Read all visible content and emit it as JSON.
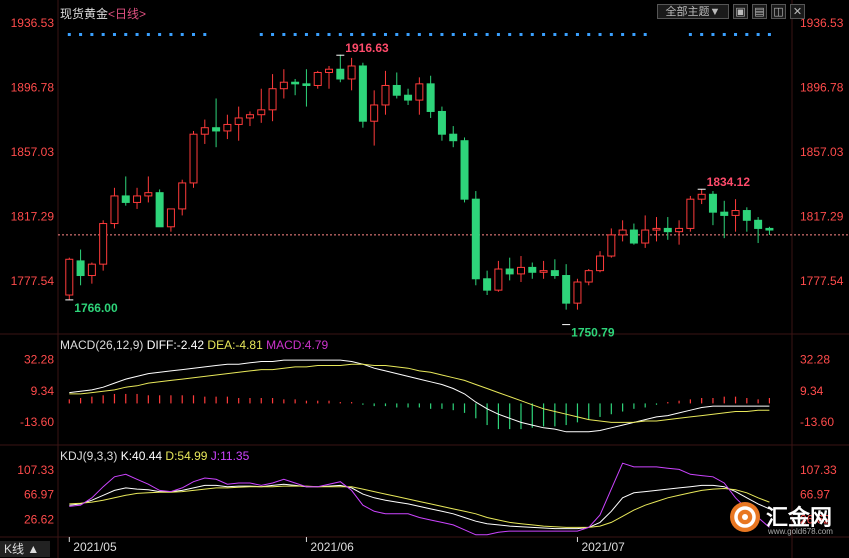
{
  "header": {
    "title": "现货黄金",
    "period": "<日线>",
    "theme_button": "全部主题▼",
    "icons": [
      "zoom-in-icon",
      "zoom-out-icon",
      "fullscreen-icon",
      "close-icon"
    ]
  },
  "macd": {
    "label": "MACD(26,12,9)",
    "diff": "DIFF:-2.42",
    "dea": "DEA:-4.81",
    "macd": "MACD:4.79"
  },
  "kdj": {
    "label": "KDJ(9,3,3)",
    "k": "K:40.44",
    "d": "D:54.99",
    "j": "J:11.35"
  },
  "footer": {
    "kline_tab": "K线",
    "brand": "汇金网",
    "brand_url": "www.gold678.com"
  },
  "colors": {
    "up": "#ff3b3b",
    "down": "#2ed47a",
    "diff": "#ffffff",
    "dea": "#e8e85a",
    "macd_label": "#cc33cc",
    "k": "#ffffff",
    "d": "#e8e85a",
    "j": "#cc44ff",
    "grid": "#2a1010",
    "axis_text": "#ff4b4b"
  },
  "chart_data": {
    "type": "candlestick",
    "y_ticks_price": [
      "1936.53",
      "1896.78",
      "1857.03",
      "1817.29",
      "1777.54"
    ],
    "y_ticks_macd": [
      "32.28",
      "9.34",
      "-13.60"
    ],
    "y_ticks_kdj": [
      "107.33",
      "66.97",
      "26.62"
    ],
    "x_ticks": [
      "2021/05",
      "2021/06",
      "2021/07"
    ],
    "annotations": {
      "high1": "1916.63",
      "low1": "1766.00",
      "low2": "1750.79",
      "high2": "1834.12"
    },
    "last_price": 1806,
    "ylim_price": [
      1745,
      1942
    ],
    "ylim_macd": [
      -30,
      38
    ],
    "ylim_kdj": [
      0,
      120
    ],
    "candles": [
      [
        1769,
        1792,
        1766,
        1791
      ],
      [
        1790,
        1797,
        1775,
        1781
      ],
      [
        1781,
        1789,
        1776,
        1788
      ],
      [
        1788,
        1815,
        1784,
        1813
      ],
      [
        1813,
        1835,
        1810,
        1830
      ],
      [
        1830,
        1842,
        1824,
        1826
      ],
      [
        1826,
        1835,
        1822,
        1830
      ],
      [
        1830,
        1842,
        1826,
        1832
      ],
      [
        1832,
        1834,
        1812,
        1811
      ],
      [
        1811,
        1822,
        1808,
        1822
      ],
      [
        1822,
        1840,
        1818,
        1838
      ],
      [
        1838,
        1870,
        1835,
        1868
      ],
      [
        1868,
        1877,
        1862,
        1872
      ],
      [
        1872,
        1890,
        1860,
        1870
      ],
      [
        1870,
        1880,
        1865,
        1874
      ],
      [
        1874,
        1885,
        1864,
        1878
      ],
      [
        1878,
        1882,
        1873,
        1880
      ],
      [
        1880,
        1896,
        1875,
        1883
      ],
      [
        1883,
        1905,
        1876,
        1896
      ],
      [
        1896,
        1908,
        1890,
        1900
      ],
      [
        1900,
        1902,
        1892,
        1899
      ],
      [
        1899,
        1908,
        1885,
        1898
      ],
      [
        1898,
        1907,
        1896,
        1906
      ],
      [
        1906,
        1910,
        1896,
        1908
      ],
      [
        1908,
        1917,
        1900,
        1902
      ],
      [
        1902,
        1915,
        1895,
        1910
      ],
      [
        1910,
        1912,
        1872,
        1876
      ],
      [
        1876,
        1895,
        1861,
        1886
      ],
      [
        1886,
        1907,
        1880,
        1898
      ],
      [
        1898,
        1906,
        1890,
        1892
      ],
      [
        1892,
        1896,
        1886,
        1889
      ],
      [
        1889,
        1903,
        1880,
        1899
      ],
      [
        1899,
        1904,
        1878,
        1882
      ],
      [
        1882,
        1885,
        1864,
        1868
      ],
      [
        1868,
        1873,
        1860,
        1864
      ],
      [
        1864,
        1866,
        1826,
        1828
      ],
      [
        1828,
        1833,
        1775,
        1779
      ],
      [
        1779,
        1784,
        1769,
        1772
      ],
      [
        1772,
        1790,
        1771,
        1785
      ],
      [
        1785,
        1792,
        1778,
        1782
      ],
      [
        1782,
        1793,
        1777,
        1786
      ],
      [
        1786,
        1789,
        1779,
        1783
      ],
      [
        1783,
        1790,
        1779,
        1784
      ],
      [
        1784,
        1791,
        1779,
        1781
      ],
      [
        1781,
        1788,
        1760,
        1764
      ],
      [
        1764,
        1779,
        1760,
        1777
      ],
      [
        1777,
        1785,
        1775,
        1784
      ],
      [
        1784,
        1796,
        1783,
        1793
      ],
      [
        1793,
        1810,
        1792,
        1806
      ],
      [
        1806,
        1815,
        1802,
        1809
      ],
      [
        1809,
        1813,
        1800,
        1801
      ],
      [
        1801,
        1818,
        1798,
        1809
      ],
      [
        1809,
        1817,
        1802,
        1810
      ],
      [
        1810,
        1817,
        1803,
        1808
      ],
      [
        1808,
        1815,
        1800,
        1810
      ],
      [
        1810,
        1830,
        1808,
        1828
      ],
      [
        1828,
        1834,
        1825,
        1831
      ],
      [
        1831,
        1833,
        1812,
        1820
      ],
      [
        1820,
        1827,
        1804,
        1818
      ],
      [
        1818,
        1828,
        1808,
        1821
      ],
      [
        1821,
        1823,
        1808,
        1815
      ],
      [
        1815,
        1817,
        1801,
        1810
      ],
      [
        1810,
        1811,
        1806,
        1809
      ]
    ],
    "macd_hist": [
      3,
      4,
      5,
      6,
      7,
      7,
      7,
      6,
      6,
      6,
      6,
      6,
      5,
      5,
      5,
      4,
      4,
      4,
      4,
      3,
      3,
      2,
      2,
      2,
      1,
      1,
      -1,
      -2,
      -2,
      -3,
      -3,
      -3,
      -4,
      -4,
      -5,
      -7,
      -11,
      -16,
      -19,
      -19,
      -19,
      -18,
      -17,
      -17,
      -16,
      -14,
      -12,
      -10,
      -8,
      -6,
      -4,
      -3,
      -1,
      1,
      2,
      3,
      4,
      4,
      5,
      5,
      4,
      3,
      4
    ],
    "macd_diff": [
      8,
      9,
      10,
      12,
      15,
      18,
      20,
      22,
      23,
      24,
      25,
      26,
      27,
      28,
      29,
      29,
      30,
      31,
      31,
      32,
      32,
      32,
      32,
      32,
      32,
      31,
      29,
      26,
      24,
      22,
      20,
      18,
      16,
      14,
      11,
      7,
      1,
      -4,
      -8,
      -11,
      -14,
      -16,
      -18,
      -19,
      -21,
      -21,
      -21,
      -20,
      -18,
      -16,
      -14,
      -12,
      -10,
      -9,
      -7,
      -5,
      -3,
      -2,
      -2,
      -2,
      -2,
      -2,
      -2
    ],
    "macd_dea": [
      7,
      7,
      8,
      9,
      10,
      12,
      13,
      15,
      16,
      17,
      18,
      19,
      20,
      21,
      22,
      23,
      24,
      25,
      25,
      26,
      27,
      27,
      28,
      28,
      28,
      29,
      29,
      28,
      28,
      27,
      26,
      24,
      23,
      21,
      19,
      17,
      14,
      11,
      8,
      5,
      2,
      -1,
      -4,
      -6,
      -8,
      -10,
      -12,
      -13,
      -14,
      -14,
      -14,
      -13,
      -13,
      -12,
      -11,
      -10,
      -9,
      -8,
      -7,
      -6,
      -6,
      -5,
      -5
    ],
    "kdj_k": [
      50,
      52,
      58,
      66,
      74,
      78,
      76,
      75,
      72,
      72,
      74,
      78,
      82,
      82,
      80,
      81,
      81,
      80,
      82,
      84,
      82,
      80,
      80,
      81,
      82,
      78,
      68,
      62,
      58,
      55,
      52,
      48,
      44,
      40,
      36,
      30,
      24,
      20,
      18,
      16,
      15,
      14,
      13,
      12,
      12,
      12,
      14,
      22,
      40,
      62,
      70,
      72,
      74,
      76,
      78,
      80,
      82,
      82,
      80,
      72,
      62,
      52,
      44
    ],
    "kdj_d": [
      52,
      53,
      55,
      58,
      62,
      66,
      69,
      70,
      71,
      71,
      72,
      74,
      76,
      78,
      78,
      79,
      80,
      80,
      80,
      81,
      81,
      81,
      80,
      80,
      80,
      80,
      76,
      72,
      68,
      64,
      60,
      56,
      52,
      48,
      44,
      40,
      36,
      30,
      26,
      22,
      20,
      18,
      16,
      15,
      14,
      14,
      14,
      16,
      22,
      32,
      42,
      50,
      56,
      62,
      66,
      70,
      74,
      76,
      77,
      75,
      70,
      62,
      55
    ],
    "kdj_j": [
      48,
      50,
      62,
      80,
      96,
      100,
      92,
      84,
      74,
      72,
      78,
      88,
      94,
      92,
      84,
      86,
      86,
      82,
      86,
      92,
      86,
      80,
      80,
      84,
      88,
      74,
      50,
      40,
      36,
      36,
      36,
      30,
      26,
      22,
      18,
      10,
      2,
      2,
      6,
      8,
      8,
      8,
      8,
      8,
      8,
      8,
      14,
      34,
      76,
      118,
      112,
      112,
      112,
      110,
      108,
      100,
      98,
      96,
      86,
      62,
      44,
      30,
      14
    ]
  }
}
